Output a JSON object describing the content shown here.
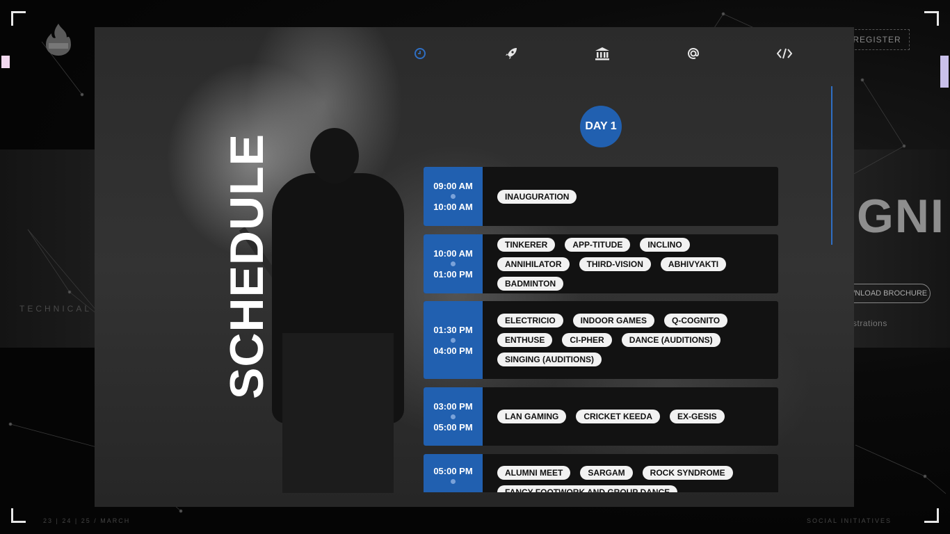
{
  "background": {
    "register_label": "REGISTER",
    "brand_text": "GNI",
    "brochure_label": "WNLOAD BROCHURE",
    "registrations_text": "strations",
    "technical_text": "TECHNICAL",
    "dates_text": "23 | 24 | 25 / MARCH",
    "social_text": "SOCIAL INITIATIVES"
  },
  "modal": {
    "title": "SCHEDULE",
    "nav": [
      {
        "icon": "clock-icon",
        "glyph": "◷",
        "active": true
      },
      {
        "icon": "rocket-icon",
        "glyph": "➶",
        "active": false
      },
      {
        "icon": "bank-icon",
        "glyph": "⌂",
        "active": false
      },
      {
        "icon": "at-icon",
        "glyph": "@",
        "active": false
      },
      {
        "icon": "code-icon",
        "glyph": "</>",
        "active": false
      }
    ],
    "day_label": "DAY 1",
    "slots": [
      {
        "start": "09:00 AM",
        "end": "10:00 AM",
        "events": [
          "INAUGURATION"
        ]
      },
      {
        "start": "10:00 AM",
        "end": "01:00 PM",
        "events": [
          "TINKERER",
          "APP-TITUDE",
          "INCLINO",
          "ANNIHILATOR",
          "THIRD-VISION",
          "ABHIVYAKTI",
          "BADMINTON"
        ]
      },
      {
        "start": "01:30 PM",
        "end": "04:00 PM",
        "events": [
          "ELECTRICIO",
          "INDOOR GAMES",
          "Q-COGNITO",
          "ENTHUSE",
          "CI-PHER",
          "DANCE (AUDITIONS)",
          "SINGING (AUDITIONS)"
        ]
      },
      {
        "start": "03:00 PM",
        "end": "05:00 PM",
        "events": [
          "LAN GAMING",
          "CRICKET KEEDA",
          "EX-GESIS"
        ]
      },
      {
        "start": "05:00 PM",
        "end": "",
        "events": [
          "ALUMNI MEET",
          "SARGAM",
          "ROCK SYNDROME",
          "FANCY FOOTWORK AND GROUP DANCE"
        ]
      }
    ]
  },
  "colors": {
    "accent": "#2160b0",
    "tag_bg": "#f2f2f2",
    "slot_bg": "#121212"
  }
}
